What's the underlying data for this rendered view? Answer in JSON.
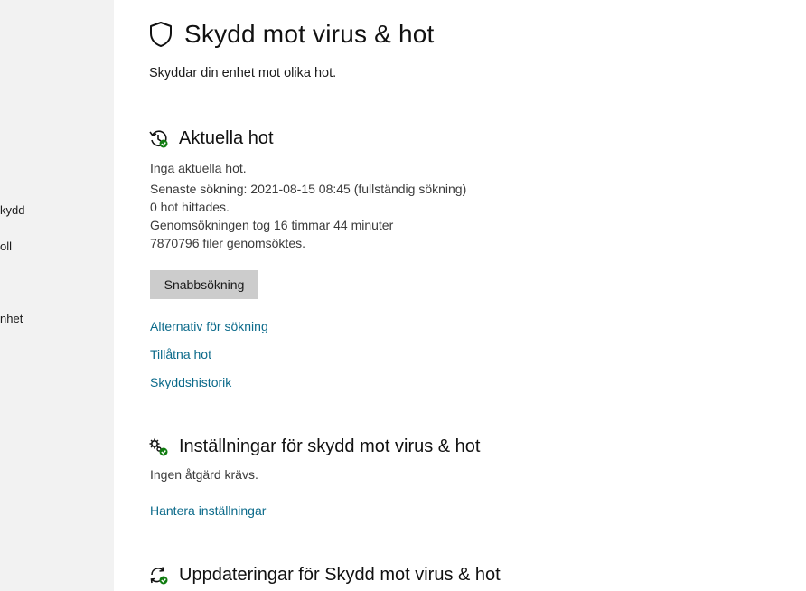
{
  "sidebar": {
    "items": [
      {
        "label": "kydd"
      },
      {
        "label": "oll"
      },
      {
        "label": "nhet"
      }
    ]
  },
  "page": {
    "title": "Skydd mot virus & hot",
    "subtitle": "Skyddar din enhet mot olika hot."
  },
  "current_threats": {
    "title": "Aktuella hot",
    "status": "Inga aktuella hot.",
    "last_scan": "Senaste sökning: 2021-08-15 08:45 (fullständig sökning)",
    "threats_found": "0 hot hittades.",
    "duration": "Genomsökningen tog 16 timmar 44 minuter",
    "files_scanned": "7870796 filer genomsöktes.",
    "quick_scan_label": "Snabbsökning",
    "links": {
      "scan_options": "Alternativ för sökning",
      "allowed_threats": "Tillåtna hot",
      "protection_history": "Skyddshistorik"
    }
  },
  "settings": {
    "title": "Inställningar för skydd mot virus & hot",
    "status": "Ingen åtgärd krävs.",
    "manage_link": "Hantera inställningar"
  },
  "updates": {
    "title": "Uppdateringar för Skydd mot virus & hot"
  },
  "colors": {
    "accent_link": "#0b6a8a",
    "status_ok": "#107c10",
    "sidebar_bg": "#f2f2f2",
    "button_bg": "#cccccc"
  }
}
